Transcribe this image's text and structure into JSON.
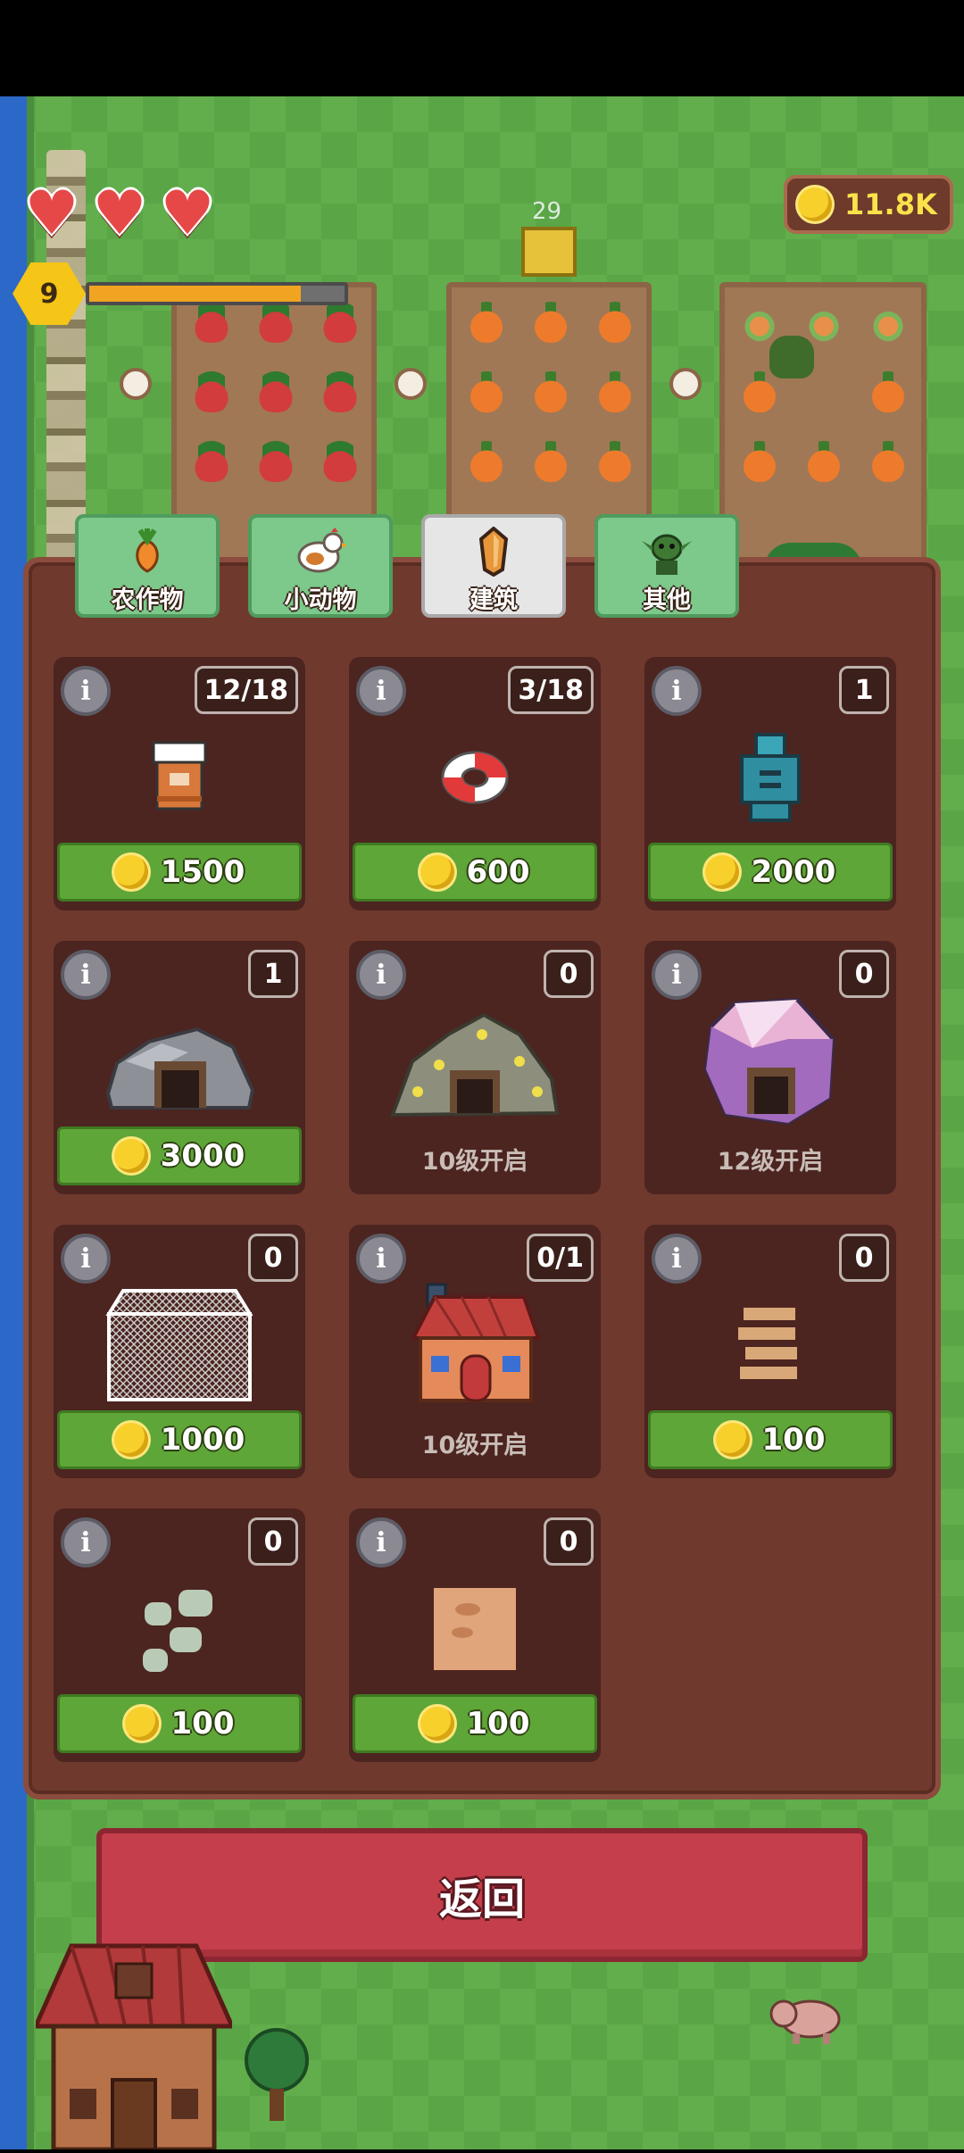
{
  "hud": {
    "hearts": 3,
    "level": "9",
    "level_progress": 0.83,
    "coins": "11.8K",
    "plot_number": "29"
  },
  "tabs": [
    {
      "label": "农作物",
      "icon": "carrot-icon",
      "active": false
    },
    {
      "label": "小动物",
      "icon": "chicken-icon",
      "active": false
    },
    {
      "label": "建筑",
      "icon": "crystal-icon",
      "active": true
    },
    {
      "label": "其他",
      "icon": "goblin-icon",
      "active": false
    }
  ],
  "items": [
    {
      "icon": "totem-icon",
      "count": "12/18",
      "price": "1500"
    },
    {
      "icon": "life-ring-icon",
      "count": "3/18",
      "price": "600"
    },
    {
      "icon": "scarecrow-icon",
      "count": "1",
      "price": "2000"
    },
    {
      "icon": "stone-mine-icon",
      "count": "1",
      "price": "3000"
    },
    {
      "icon": "gold-mine-icon",
      "count": "0",
      "locked_text": "10级开启"
    },
    {
      "icon": "crystal-mine-icon",
      "count": "0",
      "locked_text": "12级开启"
    },
    {
      "icon": "net-cage-icon",
      "count": "0",
      "price": "1000"
    },
    {
      "icon": "house-icon",
      "count": "0/1",
      "locked_text": "10级开启"
    },
    {
      "icon": "wood-path-icon",
      "count": "0",
      "price": "100"
    },
    {
      "icon": "stone-path-icon",
      "count": "0",
      "price": "100"
    },
    {
      "icon": "dirt-tile-icon",
      "count": "0",
      "price": "100"
    }
  ],
  "info_glyph": "i",
  "back_button": "返回",
  "colors": {
    "panel": "#70392e",
    "card": "#4c2420",
    "buy_button": "#5ea637",
    "back_button": "#c43f4b",
    "coin": "#f7d02c"
  }
}
